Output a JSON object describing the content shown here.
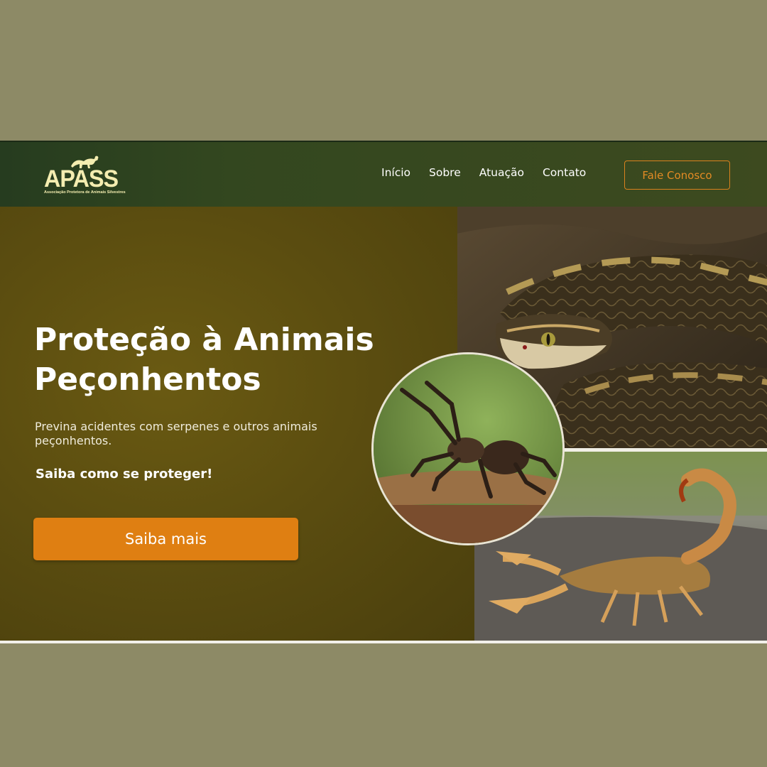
{
  "brand": {
    "name": "APASS",
    "tagline": "Associação Protetora de Animais Silvestres"
  },
  "nav": {
    "links": [
      "Início",
      "Sobre",
      "Atuação",
      "Contato"
    ],
    "cta_label": "Fale Conosco"
  },
  "hero": {
    "title_line1": "Proteção à Animais",
    "title_line2": "Peçonhentos",
    "subtitle": "Previna acidentes com serpenes e outros animais peçonhentos.",
    "cta_text": "Saiba como se proteger!",
    "button_label": "Saiba mais"
  },
  "colors": {
    "nav_bg": "#2f451f",
    "hero_bg": "#5b4d10",
    "accent": "#df7f12",
    "page_bg": "#8d8a66",
    "logo_text": "#f4edb0"
  },
  "images": [
    "snake-photo",
    "tarantula-photo",
    "scorpion-photo"
  ]
}
